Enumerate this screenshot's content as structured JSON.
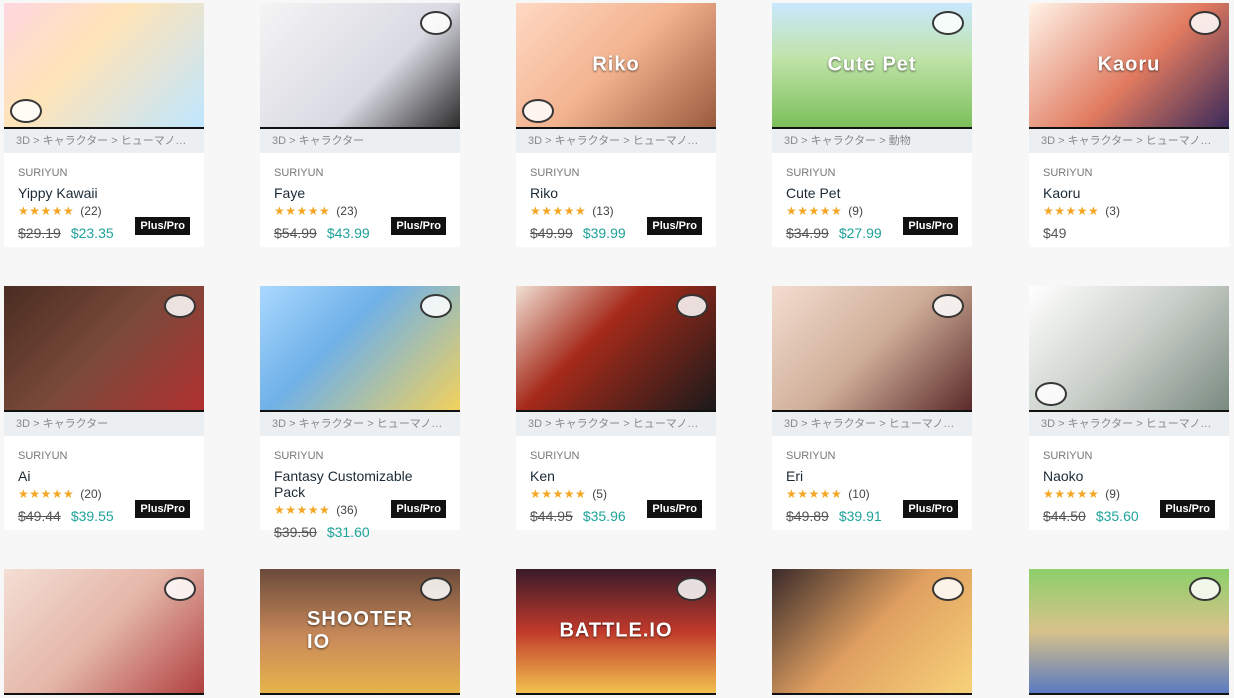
{
  "cards": [
    {
      "thumb_bg": "linear-gradient(135deg,#ffd6e0,#ffe4b8 40%,#bfe6ff)",
      "crumb": "3D > キャラクター > ヒューマノ…",
      "publisher": "SURIYUN",
      "title": "Yippy Kawaii",
      "stars": "★★★★★",
      "count": "(22)",
      "old": "$29.19",
      "new": "$23.35",
      "plus": "Plus/Pro",
      "overlay": ""
    },
    {
      "thumb_bg": "linear-gradient(135deg,#f5f5f5,#d9d9e3 60%,#2b2b2b)",
      "crumb": "3D > キャラクター",
      "publisher": "SURIYUN",
      "title": "Faye",
      "stars": "★★★★★",
      "count": "(23)",
      "old": "$54.99",
      "new": "$43.99",
      "plus": "Plus/Pro",
      "overlay": ""
    },
    {
      "thumb_bg": "linear-gradient(135deg,#ffd9c4,#f2b28e 50%,#9a5a3d)",
      "crumb": "3D > キャラクター > ヒューマノ…",
      "publisher": "SURIYUN",
      "title": "Riko",
      "stars": "★★★★★",
      "count": "(13)",
      "old": "$49.99",
      "new": "$39.99",
      "plus": "Plus/Pro",
      "overlay": "Riko"
    },
    {
      "thumb_bg": "linear-gradient(180deg,#c8e8ff,#bfe3a8 45%,#7cbf5a)",
      "crumb": "3D > キャラクター > 動物",
      "publisher": "SURIYUN",
      "title": "Cute Pet",
      "stars": "★★★★★",
      "count": "(9)",
      "old": "$34.99",
      "new": "$27.99",
      "plus": "Plus/Pro",
      "overlay": "Cute Pet"
    },
    {
      "thumb_bg": "linear-gradient(135deg,#fff4e8,#e07a5f 55%,#3a2a5a)",
      "crumb": "3D > キャラクター > ヒューマノ…",
      "publisher": "SURIYUN",
      "title": "Kaoru",
      "stars": "★★★★★",
      "count": "(3)",
      "old": "",
      "new": "",
      "only": "$49",
      "plus": "",
      "overlay": "Kaoru"
    },
    {
      "thumb_bg": "linear-gradient(135deg,#4a2d22,#7a4a3a 50%,#b03030)",
      "crumb": "3D > キャラクター",
      "publisher": "SURIYUN",
      "title": "Ai",
      "stars": "★★★★★",
      "count": "(20)",
      "old": "$49.44",
      "new": "$39.55",
      "plus": "Plus/Pro",
      "overlay": ""
    },
    {
      "thumb_bg": "linear-gradient(135deg,#a9d8ff,#6fb1e8 40%,#f2d15c)",
      "crumb": "3D > キャラクター > ヒューマノ…",
      "publisher": "SURIYUN",
      "title": "Fantasy Customizable Pack",
      "stars": "★★★★★",
      "count": "(36)",
      "old": "$39.50",
      "new": "$31.60",
      "plus": "Plus/Pro",
      "overlay": ""
    },
    {
      "thumb_bg": "linear-gradient(135deg,#f1e0d3,#a52a1a 40%,#1a1a1a)",
      "crumb": "3D > キャラクター > ヒューマノ…",
      "publisher": "SURIYUN",
      "title": "Ken",
      "stars": "★★★★★",
      "count": "(5)",
      "old": "$44.95",
      "new": "$35.96",
      "plus": "Plus/Pro",
      "overlay": ""
    },
    {
      "thumb_bg": "linear-gradient(135deg,#f3ddd0,#cfae98 50%,#5a2a2a)",
      "crumb": "3D > キャラクター > ヒューマノ…",
      "publisher": "SURIYUN",
      "title": "Eri",
      "stars": "★★★★★",
      "count": "(10)",
      "old": "$49.89",
      "new": "$39.91",
      "plus": "Plus/Pro",
      "overlay": ""
    },
    {
      "thumb_bg": "linear-gradient(135deg,#ffffff,#c9cfc8 50%,#7a8a80)",
      "crumb": "3D > キャラクター > ヒューマノ…",
      "publisher": "SURIYUN",
      "title": "Naoko",
      "stars": "★★★★★",
      "count": "(9)",
      "old": "$44.50",
      "new": "$35.60",
      "plus": "Plus/Pro",
      "overlay": ""
    },
    {
      "thumb_bg": "linear-gradient(135deg,#f4ded4,#e4b6a8 50%,#b04040)",
      "crumb": "",
      "publisher": "",
      "title": "",
      "stars": "",
      "count": "",
      "old": "",
      "new": "",
      "plus": "",
      "overlay": ""
    },
    {
      "thumb_bg": "linear-gradient(180deg,#6a4a3a,#c98a5a 55%,#e6b34a)",
      "crumb": "",
      "publisher": "",
      "title": "",
      "stars": "",
      "count": "",
      "old": "",
      "new": "",
      "plus": "",
      "overlay": "SHOOTER IO"
    },
    {
      "thumb_bg": "linear-gradient(180deg,#3a1a2a,#c0392b 50%,#f2c14e)",
      "crumb": "",
      "publisher": "",
      "title": "",
      "stars": "",
      "count": "",
      "old": "",
      "new": "",
      "plus": "",
      "overlay": "BATTLE.IO"
    },
    {
      "thumb_bg": "linear-gradient(135deg,#3a2a2a,#e0a060 50%,#f7d27a)",
      "crumb": "",
      "publisher": "",
      "title": "",
      "stars": "",
      "count": "",
      "old": "",
      "new": "",
      "plus": "",
      "overlay": ""
    },
    {
      "thumb_bg": "linear-gradient(180deg,#8ccf6a,#d8c28a 50%,#5a7ac0)",
      "crumb": "",
      "publisher": "",
      "title": "",
      "stars": "",
      "count": "",
      "old": "",
      "new": "",
      "plus": "",
      "overlay": ""
    }
  ]
}
